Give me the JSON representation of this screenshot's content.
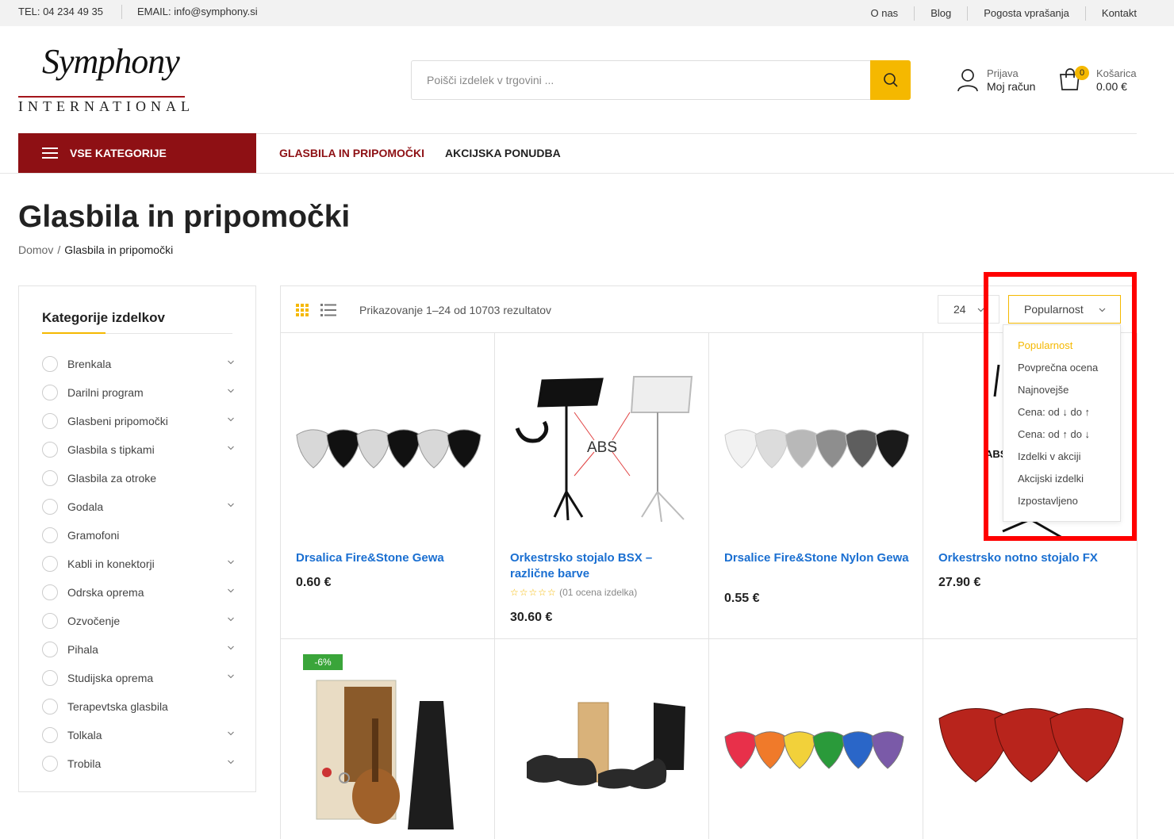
{
  "topbar": {
    "tel": "TEL: 04 234 49 35",
    "email": "EMAIL: info@symphony.si",
    "links": [
      "O nas",
      "Blog",
      "Pogosta vprašanja",
      "Kontakt"
    ]
  },
  "logo": {
    "script": "Symphony",
    "sub": "INTERNATIONAL"
  },
  "search": {
    "placeholder": "Poišči izdelek v trgovini ..."
  },
  "account": {
    "line1": "Prijava",
    "line2": "Moj račun"
  },
  "cart": {
    "count": "0",
    "line1": "Košarica",
    "line2": "0.00 €"
  },
  "nav": {
    "all_categories": "VSE KATEGORIJE",
    "item1": "GLASBILA IN PRIPOMOČKI",
    "item2": "AKCIJSKA PONUDBA"
  },
  "page": {
    "title": "Glasbila in pripomočki"
  },
  "breadcrumb": {
    "home": "Domov",
    "separator": "/",
    "current": "Glasbila in pripomočki"
  },
  "sidebar": {
    "title": "Kategorije izdelkov",
    "categories": [
      {
        "label": "Brenkala",
        "expandable": true
      },
      {
        "label": "Darilni program",
        "expandable": true
      },
      {
        "label": "Glasbeni pripomočki",
        "expandable": true
      },
      {
        "label": "Glasbila s tipkami",
        "expandable": true
      },
      {
        "label": "Glasbila za otroke",
        "expandable": false
      },
      {
        "label": "Godala",
        "expandable": true
      },
      {
        "label": "Gramofoni",
        "expandable": false
      },
      {
        "label": "Kabli in konektorji",
        "expandable": true
      },
      {
        "label": "Odrska oprema",
        "expandable": true
      },
      {
        "label": "Ozvočenje",
        "expandable": true
      },
      {
        "label": "Pihala",
        "expandable": true
      },
      {
        "label": "Studijska oprema",
        "expandable": true
      },
      {
        "label": "Terapevtska glasbila",
        "expandable": false
      },
      {
        "label": "Tolkala",
        "expandable": true
      },
      {
        "label": "Trobila",
        "expandable": true
      }
    ]
  },
  "toolbar": {
    "result_count": "Prikazovanje 1–24 od 10703 rezultatov",
    "per_page": "24",
    "orderby": "Popularnost"
  },
  "orderby_options": [
    {
      "label": "Popularnost",
      "active": true
    },
    {
      "label": "Povprečna ocena",
      "active": false
    },
    {
      "label": "Najnovejše",
      "active": false
    },
    {
      "label": "Cena: od ↓ do ↑",
      "active": false
    },
    {
      "label": "Cena: od ↑ do ↓",
      "active": false
    },
    {
      "label": "Izdelki v akciji",
      "active": false
    },
    {
      "label": "Akcijski izdelki",
      "active": false
    },
    {
      "label": "Izpostavljeno",
      "active": false
    }
  ],
  "products": [
    {
      "title": "Drsalica Fire&Stone Gewa",
      "price": "0.60 €"
    },
    {
      "title": "Orkestrsko stojalo BSX – različne barve",
      "price": "30.60 €",
      "stars": "☆☆☆☆☆",
      "rating": "(01 ocena izdelka)"
    },
    {
      "title": "Drsalice Fire&Stone Nylon Gewa",
      "price": "0.55 €"
    },
    {
      "title": "Orkestrsko notno stojalo FX",
      "price": "27.90 €"
    }
  ],
  "sale_badge": "-6%",
  "colors": {
    "brand_red": "#8e1014",
    "accent_yellow": "#f5b800",
    "link_blue": "#1a6fd1",
    "highlight": "#ff0000"
  }
}
